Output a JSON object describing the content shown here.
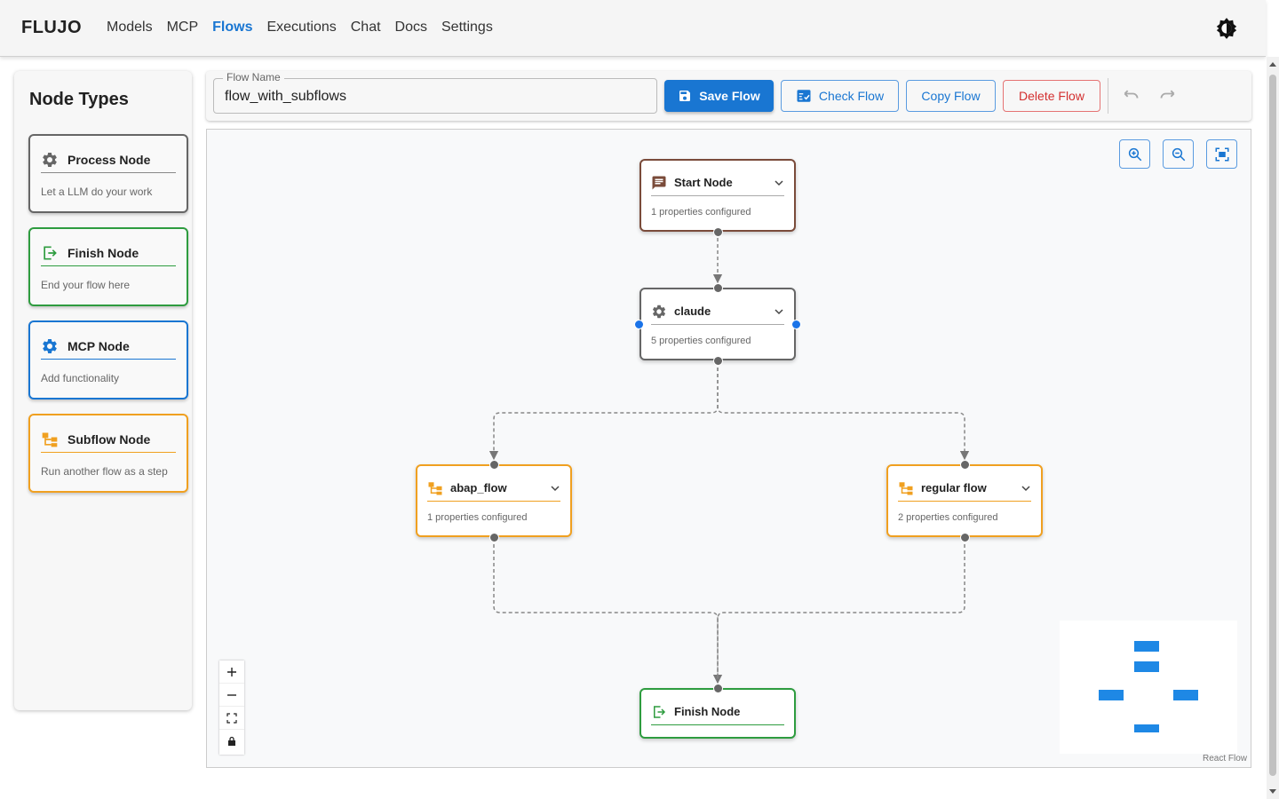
{
  "app": {
    "brand": "FLUJO",
    "nav": [
      "Models",
      "MCP",
      "Flows",
      "Executions",
      "Chat",
      "Docs",
      "Settings"
    ],
    "active_nav": "Flows"
  },
  "sidebar": {
    "title": "Node Types",
    "items": [
      {
        "title": "Process Node",
        "desc": "Let a LLM do your work",
        "icon": "gear-icon",
        "color": "#666666"
      },
      {
        "title": "Finish Node",
        "desc": "End your flow here",
        "icon": "exit-icon",
        "color": "#2e9c3f"
      },
      {
        "title": "MCP Node",
        "desc": "Add functionality",
        "icon": "gear-icon",
        "color": "#1976d2"
      },
      {
        "title": "Subflow Node",
        "desc": "Run another flow as a step",
        "icon": "subflow-icon",
        "color": "#f0a020"
      }
    ]
  },
  "toolbar": {
    "name_label": "Flow Name",
    "name_value": "flow_with_subflows",
    "save_label": "Save Flow",
    "check_label": "Check Flow",
    "copy_label": "Copy Flow",
    "delete_label": "Delete Flow"
  },
  "flow": {
    "nodes": [
      {
        "id": "start",
        "title": "Start Node",
        "sub": "1 properties configured",
        "icon": "chat-icon",
        "color": "#7a4b3a"
      },
      {
        "id": "claude",
        "title": "claude",
        "sub": "5 properties configured",
        "icon": "gear-icon",
        "color": "#666666"
      },
      {
        "id": "abap",
        "title": "abap_flow",
        "sub": "1 properties configured",
        "icon": "subflow-icon",
        "color": "#f0a020"
      },
      {
        "id": "regular",
        "title": "regular flow",
        "sub": "2 properties configured",
        "icon": "subflow-icon",
        "color": "#f0a020"
      },
      {
        "id": "finish",
        "title": "Finish Node",
        "sub": "",
        "icon": "exit-icon",
        "color": "#2e9c3f"
      }
    ],
    "edges": [
      [
        "start",
        "claude"
      ],
      [
        "claude",
        "abap"
      ],
      [
        "claude",
        "regular"
      ],
      [
        "abap",
        "finish"
      ],
      [
        "regular",
        "finish"
      ]
    ]
  },
  "canvas": {
    "attribution": "React Flow"
  },
  "colors": {
    "accent": "#1976d2",
    "danger": "#d32f2f"
  }
}
